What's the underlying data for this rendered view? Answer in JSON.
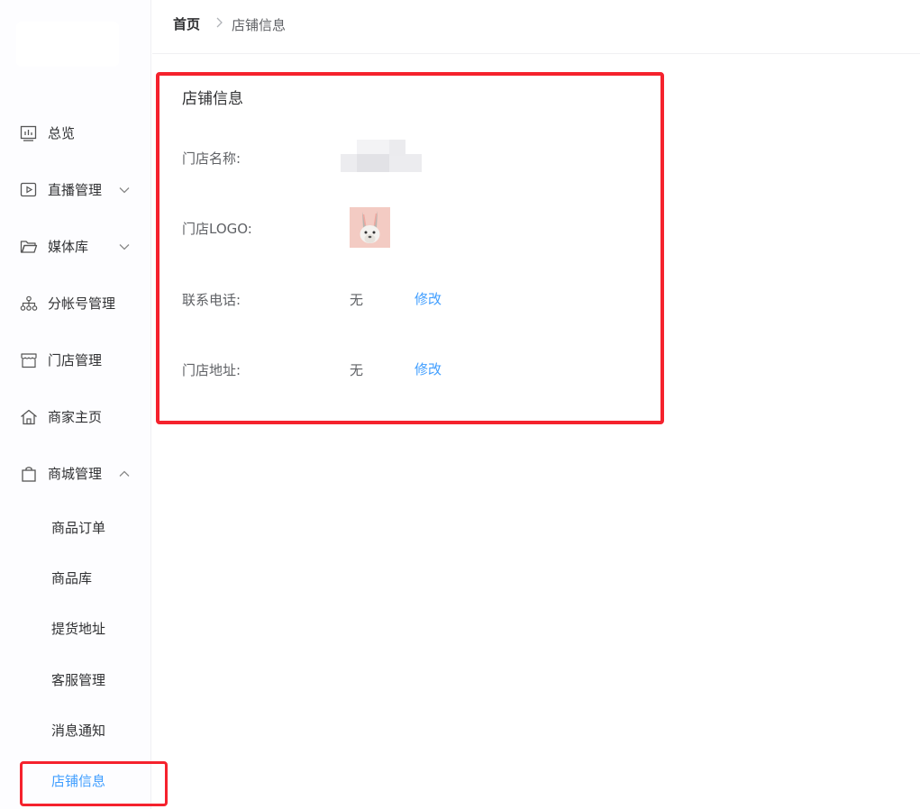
{
  "sidebar": {
    "items": [
      {
        "label": "总览",
        "icon": "chart-icon"
      },
      {
        "label": "直播管理",
        "icon": "play-icon"
      },
      {
        "label": "媒体库",
        "icon": "folder-icon"
      },
      {
        "label": "分帐号管理",
        "icon": "network-icon"
      },
      {
        "label": "门店管理",
        "icon": "store-icon"
      },
      {
        "label": "商家主页",
        "icon": "home-icon"
      },
      {
        "label": "商城管理",
        "icon": "bag-icon"
      }
    ],
    "mall_sub": [
      {
        "label": "商品订单"
      },
      {
        "label": "商品库"
      },
      {
        "label": "提货地址"
      },
      {
        "label": "客服管理"
      },
      {
        "label": "消息通知"
      },
      {
        "label": "店铺信息"
      }
    ]
  },
  "breadcrumb": {
    "home": "首页",
    "current": "店铺信息"
  },
  "card": {
    "title": "店铺信息",
    "store_name_label": "门店名称:",
    "logo_label": "门店LOGO:",
    "phone_label": "联系电话:",
    "phone_value": "无",
    "phone_edit": "修改",
    "address_label": "门店地址:",
    "address_value": "无",
    "address_edit": "修改"
  },
  "colors": {
    "accent": "#409eff",
    "highlight": "#f5222d"
  }
}
